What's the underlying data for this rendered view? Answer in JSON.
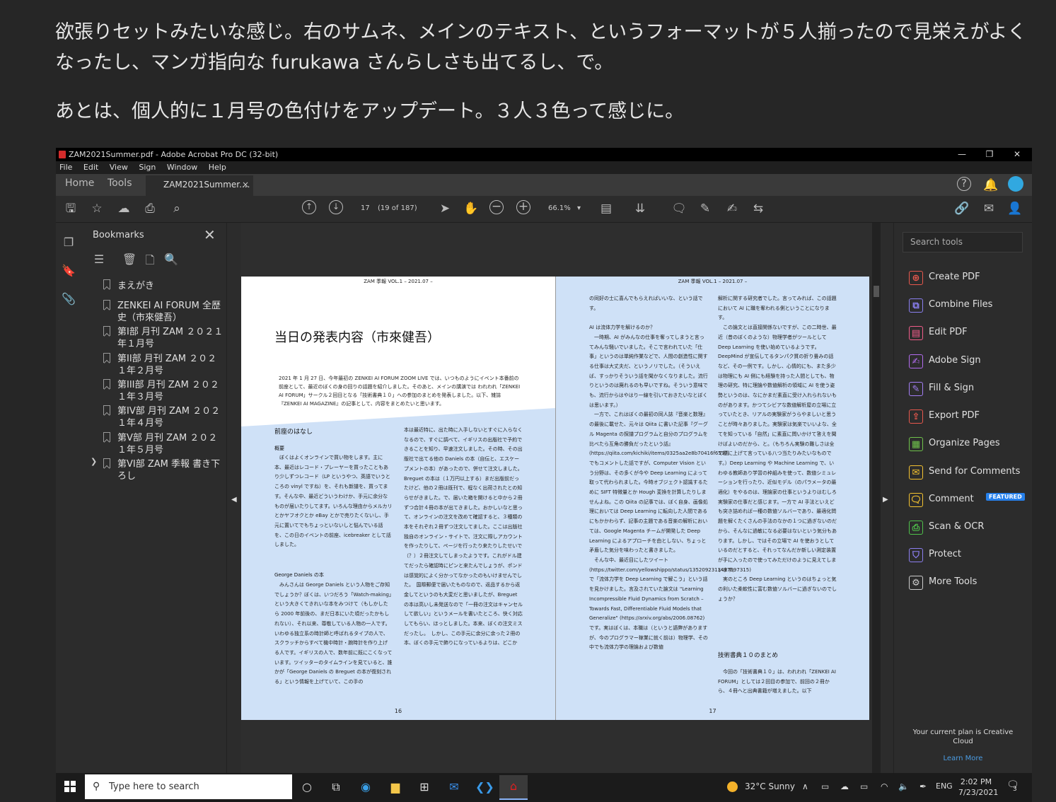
{
  "blog": {
    "paragraph1": "欲張りセットみたいな感じ。右のサムネ、メインのテキスト、というフォーマットが５人揃ったので見栄えがよくなったし、マンガ指向な furukawa さんらしさも出てるし、で。",
    "paragraph2": "あとは、個人的に１月号の色付けをアップデート。３人３色って感じに。"
  },
  "window": {
    "title": "ZAM2021Summer.pdf - Adobe Acrobat Pro DC (32-bit)",
    "controls": {
      "minimize": "—",
      "restore": "❐",
      "close": "✕"
    }
  },
  "menu": [
    "File",
    "Edit",
    "View",
    "Sign",
    "Window",
    "Help"
  ],
  "tabs": {
    "home": "Home",
    "tools": "Tools",
    "document": "ZAM2021Summer....",
    "close": "×"
  },
  "toolbar": {
    "page_current": "17",
    "page_info": "(19 of 187)",
    "zoom": "66.1%"
  },
  "bookmarks": {
    "title": "Bookmarks",
    "close": "✕",
    "items": [
      "まえがき",
      "ZENKEI AI FORUM 全歴史（市來健吾）",
      "第I部 月刊 ZAM ２０２１年１月号",
      "第II部 月刊 ZAM ２０２１年２月号",
      "第III部 月刊 ZAM ２０２１年３月号",
      "第IV部 月刊 ZAM ２０２１年４月号",
      "第V部 月刊 ZAM ２０２１年５月号",
      "第VI部 ZAM 季報 書き下ろし"
    ]
  },
  "pages": {
    "left": {
      "header": "ZAM 季報 VOL.1 – 2021.07 –",
      "title": "当日の発表内容（市來健吾）",
      "intro": "2021 年 1 月 27 日、今年最初の ZENKEI AI FORUM ZOOM LIVE では、いつものようにイベント本番前の前座として、最近のぼくの身の回りの話題を紹介しました。そのあと、メインの講演では われわれ「ZENKEI AI FORUM」サークル２回目となる「技術書典１０」への参加のまとめを発表しました。以下、雑誌『ZENKEI AI MAGAZINE』の記事として、内容をまとめたいと思います。",
      "section1": "前座のはなし",
      "sub1": "概要",
      "col1a": "　ぼくはよくオンラインで買い物をします。主に本、最近はレコード・プレーヤーを買ったこともあり少しずつレコード（LP というやつ、英語でいうところの vinyl ですね）を、それも新譜を、買ってます。そんな中、最近どういうわけか、手元に余分なものが届いたりしてます。いろんな理由からメルカリとかヤフオクとか eBay とかで売りたくないし、手元に置いてでもちょっといないしと悩んでいる話を、この日のイベントの前座、icebreaker として話しました。",
      "sub2": "George Daniels の本",
      "col1b": "　みんさんは George Daniels という人物をご存知でしょうか？ぼくは、いつだろう「Watch-making」という大きくてきれいな本をみつけて（もしかしたら 2000 年前後の、まだ日本にいた頃だったかもしれない）、それ以来、尊敬している人物の一人です。いわゆる独立系の時計師と呼ばれるタイプの人で、スクラッチからすべて機中時計・腕時計を作り上げる人です。イギリスの人で、数年前に既にこくなっています。ツイッターのタイムラインを見ていると、誰かが「George Daniels の Breguet の本が復刻される」という情報を上げていて、この手の",
      "col2": "本は最近特に、出た時に入手しないとすぐに入らなくなるので、すぐに調べて、イギリスの出版社で予約できることを知り、早速注文しました。その時、その出版社で出てる他の Daniels の本（自伝と、エスケープメントの本）があったので、併せて注文しました。　Breguet の本は（１万円以上する）まだ出版前だったけど、他の２冊は既刊で、程なく出荷されたとの知らせがきました。で、届いた箱を開けると中から２冊ずつ合計４冊の本が出てきました。おかしいなと思って、オンラインの注文を改めて確認すると、３種類の本をそれぞれ２冊ずつ注文してました。ここは出版社独自のオンライン・サイトで、注文に際しアカウントを作ったりして、ページを行ったり来たりしたせいで（？）２冊注文してしまったようです。これがドル建てだったら確認時にピンと来たんでしょうが、ポンドは感覚的によく分かってなかったのもいけませんでした。　国際郵便で届いたものなので、返品するから返金してというのも大変だと思いましたが、Breguet の本は高いし未発送なので「一冊の注文はキャンセルして欲しい」というメールを書いたところ、快く対応してもらい、ほっとしました。本来、ぼくの注文ミスだったし。　しかし、この手元に余分に余った２冊の本、ぼくの手元で飾りになっているよりは、どこか",
      "footer": "16"
    },
    "right": {
      "header": "ZAM 季報 VOL.1 – 2021.07 –",
      "col1": "の同好の士に喜んでもらえればいいな、という話です。\n\nAI は流体力学を解けるのか？\n　一時期、AI がみんなの仕事を奪ってしまうと言ってみんな騒いでいました。そこで言われていた「仕事」というのは単純作業などで、人間の創造性に関する仕事は大丈夫だ、というノリでした。（そういえば、すっかりそういう話を聞かなくなりました。流行りというのは廃れるのも早いですね。そういう意味でも、流行からはやはり一線を引いておきたいなとぼくは思います。）\n　一方で、これはぼくの最初の同人誌『音楽と数理』の最後に載せた、元々は Qiita に書いた記事『グーグル Magenta の探譜プログラムと自分のプログラムを比べたら互角の勝負だったという話』(https://qiita.com/kichiki/items/0325aa2e8b70416f6597) でもコメントした話ですが、Computer Vision という分野は、その多くが今や Deep Learning によって取って代わられました。今時オブジェクト認識するために SIFT 特徴量とか Hough 変換を計算したりしませんよね。この Qiita の記事では、ぼく自身、画像処理においては Deep Learning に転向した人間であるにもかかわらず、記事の主題である音楽の解析においては、Google Magenta チームが開発した Deep Learning によるアプローチを由としない、ちょっと矛盾した気分を味わったと書きました。\n　そんな中、最近目にしたツイート (https://twitter.com/yellowshippo/status/1352092313497997315) で「流体力学を Deep Learning で解こう」という話を見かけました。言及されていた論文は \"Learning Incompressible Fluid Dynamics from Scratch – Towards Fast, Differentiable Fluid Models that Generalize\" (https://arxiv.org/abs/2006.08762) です。実はぼくは、本職は（というと語弊がありますが、今のプログラマー稼業に就く前は）物理学、その中でも流体力学の理論および数値",
      "col2": "解析に関する研究者でした。言ってみれば、この話題において AI に職を奪われる側ということになります。\n　この論文とは直接関係ないですが、この二時世、最近（昔のぼくのような）物理学者がツールとして Deep Learning を使い始めているようです。DeepMind が宣伝してるタンパク質の折り畳みの話など、その一例です。しかし、心情的にも、また多少は物理にも AI 側にも経験を持った人間としても、物理の研究、特に理論や数値解析の領域に AI を使う姿勢というのは、なにかまだ素直に受け入れられないものがあります。かつてシビアな数値解析屋の立場に立っていたとき、リアルの実験家がうらやましいと思うことが時々ありました。実験家は気楽でいいよな、全てを知っている「自然」に素直に問いかけて答えを聞けばよいのだから、と。（もちろん実験の難しさは全て棚に上げて言っている八つ当たりみたいなものです。）Deep Learning や Machine Learning で、いわゆる教師あり学習の枠組みを使って、数値シミュレーションを行ったり、近似モデル（のパラメータの最適化）をやるのは、理論家の仕事というよりはむしろ実験家の仕事だと感じます。一方で AI 手法といえども突き詰めれば一種の数値ソルバーであり、最適化問題を解くたくさんの手法のなかの１つに過ぎないのだから、そんなに過敏になる必要はないという気分もあります。しかし、ではその立場で AI を使おうとしているのだとすると、それってなんだか新しい測定装置が手に入ったので使ってみただけのように見えてしまいます。\n　実のところ Deep Learning というのはちょっと気の利いた柔軟性に富む数値ソルバーに過ぎないのでしょうか？",
      "section": "技術書典１０のまとめ",
      "col2b": "　今回の「技術書典１０」は、われわれ「ZENKEI AI FORUM」としては２回目の参加で、前回の２冊から、４冊へと出典書籍が増えました。以下",
      "footer": "17"
    }
  },
  "right_panel": {
    "search_placeholder": "Search tools",
    "featured_badge": "FEATURED",
    "tools": [
      {
        "label": "Create PDF",
        "icon": "create-pdf-icon",
        "color": "#e8584d"
      },
      {
        "label": "Combine Files",
        "icon": "combine-files-icon",
        "color": "#8a7ff0"
      },
      {
        "label": "Edit PDF",
        "icon": "edit-pdf-icon",
        "color": "#f05c8a"
      },
      {
        "label": "Adobe Sign",
        "icon": "adobe-sign-icon",
        "color": "#b36cf0"
      },
      {
        "label": "Fill & Sign",
        "icon": "fill-sign-icon",
        "color": "#a37ef5"
      },
      {
        "label": "Export PDF",
        "icon": "export-pdf-icon",
        "color": "#e8584d"
      },
      {
        "label": "Organize Pages",
        "icon": "organize-pages-icon",
        "color": "#6fc24b"
      },
      {
        "label": "Send for Comments",
        "icon": "send-for-comments-icon",
        "color": "#f5c330"
      },
      {
        "label": "Comment",
        "icon": "comment-icon",
        "color": "#f5c330"
      },
      {
        "label": "Scan & OCR",
        "icon": "scan-ocr-icon",
        "color": "#4fc24b"
      },
      {
        "label": "Protect",
        "icon": "protect-icon",
        "color": "#8c7ff0"
      },
      {
        "label": "More Tools",
        "icon": "more-tools-icon",
        "color": "#cccccc"
      }
    ],
    "plan_text": "Your current plan is Creative Cloud",
    "learn_more": "Learn More"
  },
  "taskbar": {
    "search_placeholder": "Type here to search",
    "weather": "32°C  Sunny",
    "language": "ENG",
    "time": "2:02 PM",
    "date": "7/23/2021",
    "notifications": "3"
  }
}
